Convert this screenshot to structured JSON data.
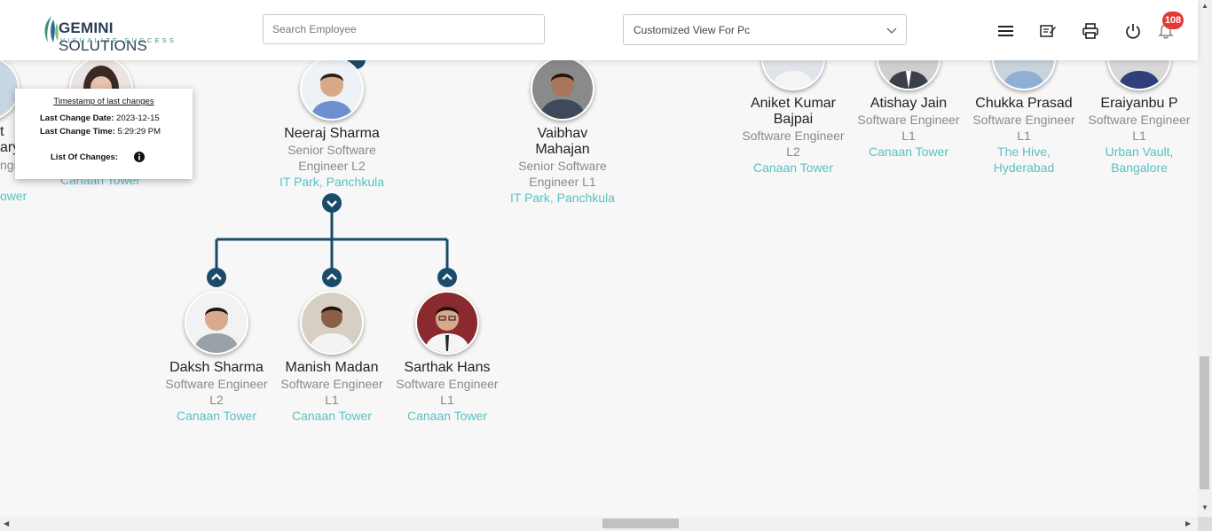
{
  "header": {
    "logo_main_bold": "GEMINI",
    "logo_main_rest": " SOLUTIONS",
    "logo_tagline": "VISUALIZE SUCCESS",
    "search_placeholder": "Search Employee",
    "view_select_value": "Customized View For Pc",
    "notification_count": "108",
    "icons": [
      "menu-icon",
      "edit-note-icon",
      "print-icon",
      "power-icon",
      "bell-icon"
    ]
  },
  "tooltip": {
    "title": "Timestamp of last changes",
    "date_label": "Last Change Date:",
    "date_value": "2023-12-15",
    "time_label": "Last Change Time:",
    "time_value": "5:29:29 PM",
    "changes_label": "List Of Changes:"
  },
  "partial_left": {
    "frag_name1": "t",
    "frag_name2": "ary",
    "frag_role": "ngi",
    "frag_loc": "ower",
    "card2_loc": "Canaan Tower"
  },
  "employees": {
    "neeraj": {
      "name": "Neeraj Sharma",
      "role1": "Senior Software",
      "role2": "Engineer L2",
      "location": "IT Park, Panchkula"
    },
    "vaibhav": {
      "name1": "Vaibhav",
      "name2": "Mahajan",
      "role1": "Senior Software",
      "role2": "Engineer L1",
      "location": "IT Park, Panchkula"
    },
    "aniket": {
      "name1": "Aniket Kumar",
      "name2": "Bajpai",
      "role1": "Software Engineer",
      "role2": "L2",
      "location": "Canaan Tower"
    },
    "atishay": {
      "name": "Atishay Jain",
      "role1": "Software Engineer",
      "role2": "L1",
      "location": "Canaan Tower"
    },
    "chukka": {
      "name": "Chukka Prasad",
      "role1": "Software Engineer",
      "role2": "L1",
      "location1": "The Hive,",
      "location2": "Hyderabad"
    },
    "eraiyanbu": {
      "name": "Eraiyanbu P",
      "role1": "Software Engineer",
      "role2": "L1",
      "location1": "Urban Vault,",
      "location2": "Bangalore"
    },
    "daksh": {
      "name": "Daksh Sharma",
      "role1": "Software Engineer",
      "role2": "L2",
      "location": "Canaan Tower"
    },
    "manish": {
      "name": "Manish Madan",
      "role1": "Software Engineer",
      "role2": "L1",
      "location": "Canaan Tower"
    },
    "sarthak": {
      "name": "Sarthak Hans",
      "role1": "Software Engineer",
      "role2": "L1",
      "location": "Canaan Tower"
    }
  },
  "colors": {
    "accent": "#1b4b6b",
    "location": "#5bc0c2",
    "badge": "#e53935"
  }
}
